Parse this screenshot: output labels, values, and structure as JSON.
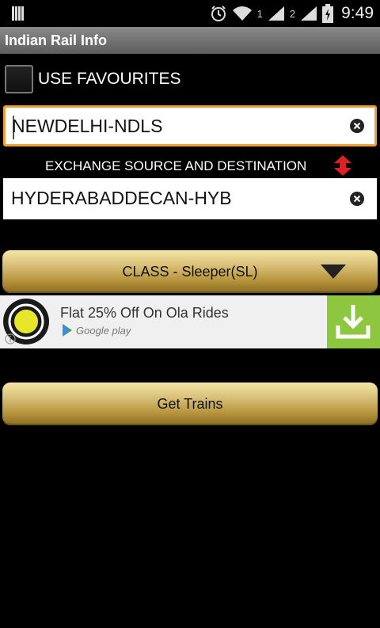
{
  "status_bar": {
    "sim1_label": "1",
    "sim2_label": "2",
    "time": "9:49"
  },
  "app": {
    "title": "Indian Rail Info"
  },
  "favourites": {
    "label": "USE FAVOURITES",
    "checked": false
  },
  "source": {
    "value": "NEWDELHI-NDLS"
  },
  "exchange": {
    "label": "EXCHANGE SOURCE AND DESTINATION"
  },
  "destination": {
    "value": "HYDERABADDECAN-HYB"
  },
  "class_select": {
    "label": "CLASS - Sleeper(SL)"
  },
  "ad": {
    "headline": "Flat 25% Off On Ola Rides",
    "store": "Google play"
  },
  "actions": {
    "get_trains": "Get Trains"
  },
  "colors": {
    "accent_focus": "#f0a030",
    "exchange_icon": "#e02020",
    "ad_download_bg": "#8dc63f"
  }
}
